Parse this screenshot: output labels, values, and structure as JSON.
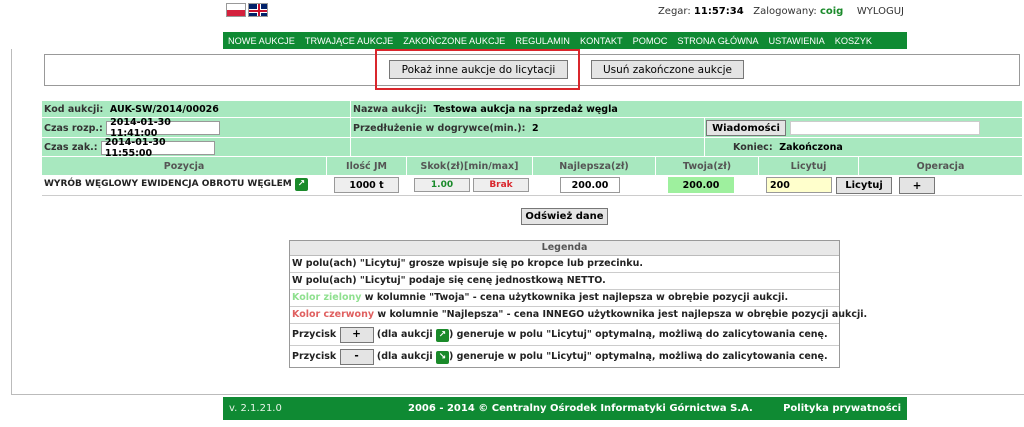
{
  "header": {
    "clock_label": "Zegar:",
    "clock_value": "11:57:34",
    "logged_label": "Zalogowany:",
    "user": "coig",
    "logout": "WYLOGUJ"
  },
  "nav": [
    "NOWE AUKCJE",
    "TRWAJĄCE AUKCJE",
    "ZAKOŃCZONE AUKCJE",
    "REGULAMIN",
    "KONTAKT",
    "POMOC",
    "STRONA GŁÓWNA",
    "USTAWIENIA",
    "KOSZYK"
  ],
  "actions": {
    "show_other": "Pokaż inne aukcje do licytacji",
    "remove_finished": "Usuń zakończone aukcje"
  },
  "auction": {
    "code_label": "Kod aukcji:",
    "code_value": "AUK-SW/2014/00026",
    "name_label": "Nazwa aukcji:",
    "name_value": "Testowa aukcja na sprzedaż węgla",
    "start_label": "Czas rozp.:",
    "start_value": "2014-01-30 11:41:00",
    "extension_label": "Przedłużenie w dogrywce(min.):",
    "extension_value": "2",
    "messages_button": "Wiadomości",
    "messages_value": "",
    "end_label": "Czas zak.:",
    "end_value": "2014-01-30 11:55:00",
    "finish_label": "Koniec:",
    "finish_value": "Zakończona"
  },
  "table": {
    "headers": {
      "position": "Pozycja",
      "qty": "Ilość JM",
      "step_prefix": "Skok(zł)[",
      "step_min": "min",
      "step_sep": "/",
      "step_max": "max",
      "step_suffix": "]",
      "best": "Najlepsza(zł)",
      "yours": "Twoja(zł)",
      "bid": "Licytuj",
      "operation": "Operacja"
    },
    "row": {
      "position": "WYRÓB WĘGLOWY EWIDENCJA OBROTU WĘGLEM",
      "qty": "1000 t",
      "step_min": "1.00",
      "step_max": "Brak",
      "best": "200.00",
      "yours": "200.00",
      "bid_value": "200",
      "bid_button": "Licytuj",
      "plus_button": "+"
    }
  },
  "refresh_button": "Odśwież dane",
  "legend": {
    "title": "Legenda",
    "line1": "W polu(ach) \"Licytuj\" grosze wpisuje się po kropce lub przecinku.",
    "line2": "W polu(ach) \"Licytuj\" podaje się cenę jednostkową NETTO.",
    "line3_colored": "Kolor zielony",
    "line3_rest": " w kolumnie \"Twoja\" - cena użytkownika jest najlepsza w obrębie pozycji aukcji.",
    "line4_colored": "Kolor czerwony",
    "line4_rest": " w kolumnie \"Najlepsza\" - cena INNEGO użytkownika jest najlepsza w obrębie pozycji aukcji.",
    "line5_a": "Przycisk",
    "line5_btn": "+",
    "line5_b": "(dla aukcji",
    "line5_c": ") generuje w polu \"Licytuj\" optymalną, możliwą do zalicytowania cenę.",
    "line6_a": "Przycisk",
    "line6_btn": "-",
    "line6_b": "(dla aukcji",
    "line6_c": ") generuje w polu \"Licytuj\" optymalną, możliwą do zalicytowania cenę."
  },
  "footer": {
    "version": "v. 2.1.21.0",
    "copyright": "2006 - 2014 © Centralny Ośrodek Informatyki Górnictwa S.A.",
    "privacy": "Polityka prywatności"
  },
  "colors": {
    "green_nav": "#0f8a33",
    "mint_row": "#a8e8bf",
    "highlight_red": "#d9262c",
    "yours_bg": "#9ef09e",
    "bid_bg": "#ffffcc"
  }
}
